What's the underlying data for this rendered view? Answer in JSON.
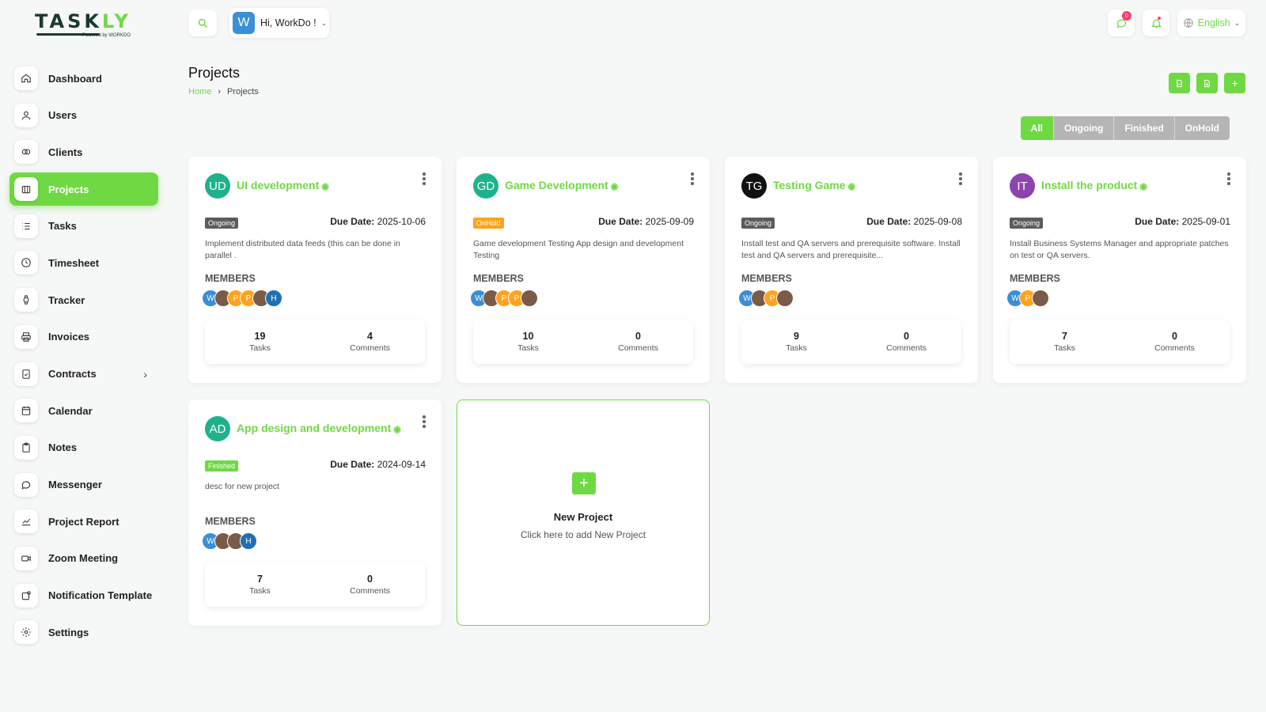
{
  "brand": {
    "name_a": "TASK",
    "name_b": "LY",
    "powered": "Powered by WORKDO"
  },
  "sidebar": {
    "items": [
      {
        "label": "Dashboard",
        "icon": "home-icon"
      },
      {
        "label": "Users",
        "icon": "user-icon"
      },
      {
        "label": "Clients",
        "icon": "clients-icon"
      },
      {
        "label": "Projects",
        "icon": "projects-icon"
      },
      {
        "label": "Tasks",
        "icon": "list-icon"
      },
      {
        "label": "Timesheet",
        "icon": "clock-icon"
      },
      {
        "label": "Tracker",
        "icon": "tracker-icon"
      },
      {
        "label": "Invoices",
        "icon": "printer-icon"
      },
      {
        "label": "Contracts",
        "icon": "contract-icon"
      },
      {
        "label": "Calendar",
        "icon": "calendar-icon"
      },
      {
        "label": "Notes",
        "icon": "clipboard-icon"
      },
      {
        "label": "Messenger",
        "icon": "chat-icon"
      },
      {
        "label": "Project Report",
        "icon": "chart-icon"
      },
      {
        "label": "Zoom Meeting",
        "icon": "video-icon"
      },
      {
        "label": "Notification Template",
        "icon": "notification-icon"
      },
      {
        "label": "Settings",
        "icon": "gear-icon"
      }
    ]
  },
  "header": {
    "user_initial": "W",
    "user_greeting": "Hi, WorkDo !",
    "message_count": "0",
    "language": "English"
  },
  "page": {
    "title": "Projects",
    "breadcrumb_home": "Home",
    "breadcrumb_current": "Projects"
  },
  "filters": {
    "all": "All",
    "ongoing": "Ongoing",
    "finished": "Finished",
    "onhold": "OnHold"
  },
  "labels": {
    "members": "MEMBERS",
    "tasks": "Tasks",
    "comments": "Comments",
    "due_date": "Due Date:"
  },
  "projects": [
    {
      "initials": "UD",
      "name": "UI development",
      "status": "Ongoing",
      "due": "2025-10-06",
      "desc": "Implement distributed data feeds (this can be done in parallel .",
      "tasks": "19",
      "comments": "4"
    },
    {
      "initials": "GD",
      "name": "Game Development",
      "status": "OnHold",
      "due": "2025-09-09",
      "desc": "Game development Testing App design and development Testing",
      "tasks": "10",
      "comments": "0"
    },
    {
      "initials": "TG",
      "name": "Testing Game",
      "status": "Ongoing",
      "due": "2025-09-08",
      "desc": "Install test and QA servers and prerequisite software. Install test and QA servers and prerequisite...",
      "tasks": "9",
      "comments": "0"
    },
    {
      "initials": "IT",
      "name": "Install the product",
      "status": "Ongoing",
      "due": "2025-09-01",
      "desc": "Install Business Systems Manager and appropriate patches on test or QA servers.",
      "tasks": "7",
      "comments": "0"
    },
    {
      "initials": "AD",
      "name": "App design and development",
      "status": "Finished",
      "due": "2024-09-14",
      "desc": "desc for new project",
      "tasks": "7",
      "comments": "0"
    }
  ],
  "member_initials": {
    "w": "W",
    "p": "P",
    "h": "H"
  },
  "new_project": {
    "title": "New Project",
    "subtitle": "Click here to add New Project"
  },
  "colors": {
    "accent": "#6fd943",
    "ongoing": "#5c5c5c",
    "onhold": "#ffa21d",
    "finished": "#6fd943",
    "avatar_teal": "#1fb18c",
    "avatar_black": "#111111",
    "avatar_purple": "#8e44ad"
  }
}
